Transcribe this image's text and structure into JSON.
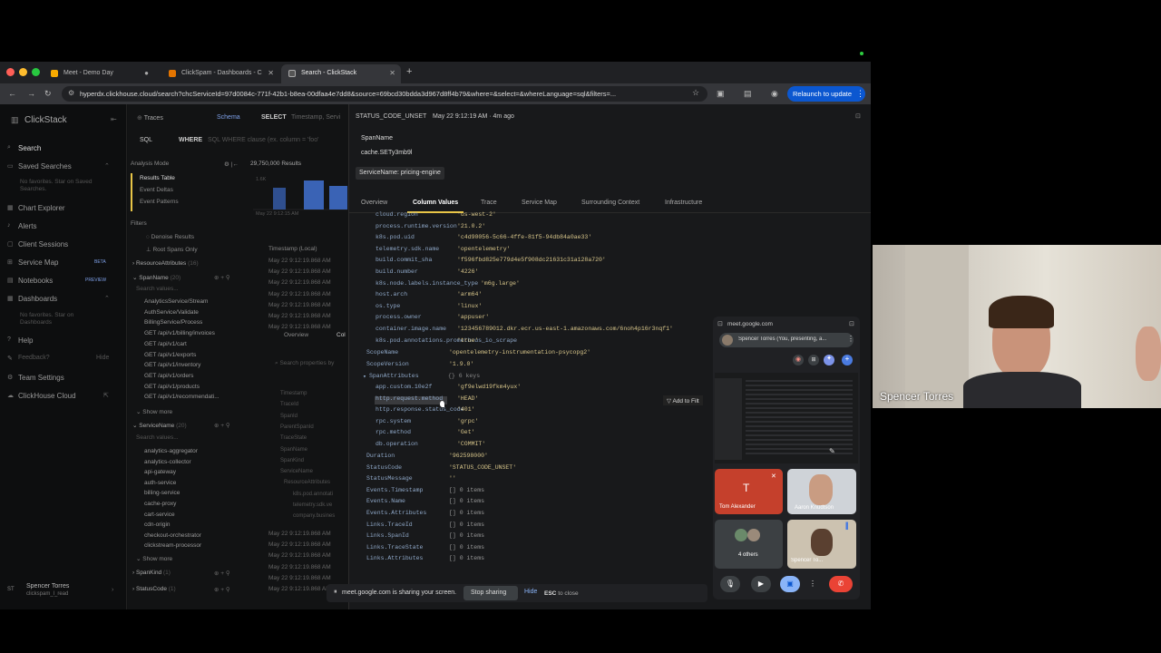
{
  "browser": {
    "tabs": [
      {
        "title": "Meet - Demo Day"
      },
      {
        "title": "ClickSpam - Dashboards - C"
      },
      {
        "title": "Search - ClickStack"
      }
    ],
    "url": "hyperdx.clickhouse.cloud/search?chcServiceId=97d0084c-771f-42b1-b8ea-00dfaa4e7dd8&source=69bcd30bdda3d967d8ff4b79&where=&select=&whereLanguage=sql&filters=...",
    "relaunch_label": "Relaunch to update"
  },
  "sidebar": {
    "brand": "ClickStack",
    "items": [
      {
        "label": "Search"
      },
      {
        "label": "Saved Searches"
      },
      {
        "label": "Chart Explorer"
      },
      {
        "label": "Alerts"
      },
      {
        "label": "Client Sessions"
      },
      {
        "label": "Service Map",
        "badge": "BETA"
      },
      {
        "label": "Notebooks",
        "badge": "PREVIEW"
      },
      {
        "label": "Dashboards"
      },
      {
        "label": "Help"
      },
      {
        "label": "Feedback?"
      },
      {
        "label": "Team Settings"
      },
      {
        "label": "ClickHouse Cloud"
      }
    ],
    "saved_hint_1": "No favorites. Star on Saved",
    "saved_hint_2": "Searches.",
    "dash_hint_1": "No favorites. Star on",
    "dash_hint_2": "Dashboards",
    "hide_label": "Hide",
    "user_initials": "ST",
    "user_name": "Spencer Torres",
    "user_sub": "clickspam_l_read"
  },
  "search": {
    "source": "Traces",
    "schema_label": "Schema",
    "select_label": "SELECT",
    "select_value": "Timestamp, Servi",
    "lang": "SQL",
    "where_label": "WHERE",
    "where_placeholder": "SQL WHERE clause (ex. column = 'foo'",
    "analysis_mode": "Analysis Mode",
    "results_count": "29,750,000 Results",
    "modes": [
      "Results Table",
      "Event Deltas",
      "Event Patterns"
    ],
    "filters_label": "Filters",
    "denoise": "Denoise Results",
    "root_spans": "Root Spans Only",
    "resource_attrs": "ResourceAttributes",
    "resource_count": "(16)",
    "spanname_label": "SpanName",
    "spanname_count": "(20)",
    "search_values": "Search values...",
    "spanname_values": [
      "AnalyticsService/Stream",
      "AuthService/Validate",
      "BillingService/Process",
      "GET /api/v1/billing/invoices",
      "GET /api/v1/cart",
      "GET /api/v1/exports",
      "GET /api/v1/inventory",
      "GET /api/v1/orders",
      "GET /api/v1/products",
      "GET /api/v1/recommendati..."
    ],
    "show_more": "Show more",
    "service_label": "ServiceName",
    "service_count": "(20)",
    "service_values": [
      "analytics-aggregator",
      "analytics-collector",
      "api-gateway",
      "auth-service",
      "billing-service",
      "cache-proxy",
      "cart-service",
      "cdn-origin",
      "checkout-orchestrator",
      "clickstream-processor"
    ],
    "spankind_label": "SpanKind",
    "spankind_count": "(1)",
    "statuscode_label": "StatusCode",
    "statuscode_count": "(1)",
    "timestamp_header": "Timestamp (Local)",
    "row_times": [
      "May 22 9:12:19.868 AM",
      "May 22 9:12:19.868 AM",
      "May 22 9:12:19.868 AM",
      "May 22 9:12:19.868 AM",
      "May 22 9:12:19.868 AM",
      "May 22 9:12:19.868 AM",
      "May 22 9:12:19.868 AM"
    ],
    "bottom_times": [
      "May 22 9:12:19.868 AM",
      "May 22 9:12:19.868 AM",
      "May 22 9:12:19.868 AM",
      "May 22 9:12:19.868 AM",
      "May 22 9:12:19.868 AM",
      "May 22 9:12:19.868 AM"
    ],
    "inner_tab1": "Overview",
    "inner_tab2": "Col",
    "search_props": "Search properties by",
    "prop_list": [
      "Timestamp",
      "TraceId",
      "SpanId",
      "ParentSpanId",
      "TraceState",
      "SpanName",
      "SpanKind",
      "ServiceName",
      "ResourceAttributes",
      "k8s.pod.annotati",
      "telemetry.sdk.ve",
      "company.busines"
    ],
    "chart_ylabel": "1.6K",
    "chart_xlabel": "May 22 9:12:15 AM"
  },
  "panel": {
    "status": "STATUS_CODE_UNSET",
    "time": "May 22 9:12:19 AM · 4m ago",
    "spanname_label": "SpanName",
    "spanname_value": "cache.SETy3mb9l",
    "service_chip": "ServiceName: pricing-engine",
    "tabs": [
      "Overview",
      "Column Values",
      "Trace",
      "Service Map",
      "Surrounding Context",
      "Infrastructure"
    ],
    "resource_rows": [
      {
        "k": "cloud.region",
        "v": "'us-west-2'"
      },
      {
        "k": "process.runtime.version",
        "v": "'21.0.2'"
      },
      {
        "k": "k8s.pod.uid",
        "v": "'c4d90056-5c66-4ffe-81f5-94db84a0ae33'"
      },
      {
        "k": "telemetry.sdk.name",
        "v": "'opentelemetry'"
      },
      {
        "k": "build.commit_sha",
        "v": "'f596fbd825e779d4e5f908dc21631c31a128a720'"
      },
      {
        "k": "build.number",
        "v": "'4226'"
      },
      {
        "k": "k8s.node.labels.instance_type",
        "v": "'m6g.large'"
      },
      {
        "k": "host.arch",
        "v": "'arm64'"
      },
      {
        "k": "os.type",
        "v": "'linux'"
      },
      {
        "k": "process.owner",
        "v": "'appuser'"
      },
      {
        "k": "container.image.name",
        "v": "'123456789012.dkr.ecr.us-east-1.amazonaws.com/6noh4p16r3nqf1'"
      },
      {
        "k": "k8s.pod.annotations.prometheus_io_scrape",
        "v": "'true'"
      }
    ],
    "scope_rows": [
      {
        "k": "ScopeName",
        "v": "'opentelemetry-instrumentation-psycopg2'"
      },
      {
        "k": "ScopeVersion",
        "v": "'1.9.0'"
      }
    ],
    "span_attrs_label": "SpanAttributes",
    "span_attrs_count": "{} 6 keys",
    "span_attr_rows": [
      {
        "k": "app.custom.10e2f",
        "v": "'gf9elwd19fkm4yux'"
      },
      {
        "k": "http.request.method",
        "v": "'HEAD'"
      },
      {
        "k": "http.response.status_code",
        "v": "'401'"
      },
      {
        "k": "rpc.system",
        "v": "'grpc'"
      },
      {
        "k": "rpc.method",
        "v": "'Get'"
      },
      {
        "k": "db.operation",
        "v": "'COMMIT'"
      }
    ],
    "add_filter": "Add to Filt",
    "tail_rows": [
      {
        "k": "Duration",
        "v": "'962598000'"
      },
      {
        "k": "StatusCode",
        "v": "'STATUS_CODE_UNSET'"
      },
      {
        "k": "StatusMessage",
        "v": "''"
      },
      {
        "k": "Events.Timestamp",
        "v": "[] 0 items"
      },
      {
        "k": "Events.Name",
        "v": "[] 0 items"
      },
      {
        "k": "Events.Attributes",
        "v": "[] 0 items"
      },
      {
        "k": "Links.TraceId",
        "v": "[] 0 items"
      },
      {
        "k": "Links.SpanId",
        "v": "[] 0 items"
      },
      {
        "k": "Links.TraceState",
        "v": "[] 0 items"
      },
      {
        "k": "Links.Attributes",
        "v": "[] 0 items"
      }
    ]
  },
  "share_bar": {
    "message": "meet.google.com is sharing your screen.",
    "stop": "Stop sharing",
    "hide": "Hide",
    "esc": "ESC",
    "to_close": "to close"
  },
  "meet": {
    "domain": "meet.google.com",
    "presenter": "Spencer Torres (You, presenting, a...",
    "tom_initial": "T",
    "tom_name": "Tom Alexander",
    "aaron_name": "Aaron Knudtson",
    "others": "4 others",
    "spencer_short": "Spencer To..."
  },
  "camera": {
    "name": "Spencer Torres"
  },
  "colors": {
    "accent": "#7ea0e8",
    "key": "#8fa8c8",
    "value": "#d7c58a",
    "tom_tile": "#c5402c",
    "hangup": "#ea4335",
    "relaunch": "#0b57d0"
  }
}
